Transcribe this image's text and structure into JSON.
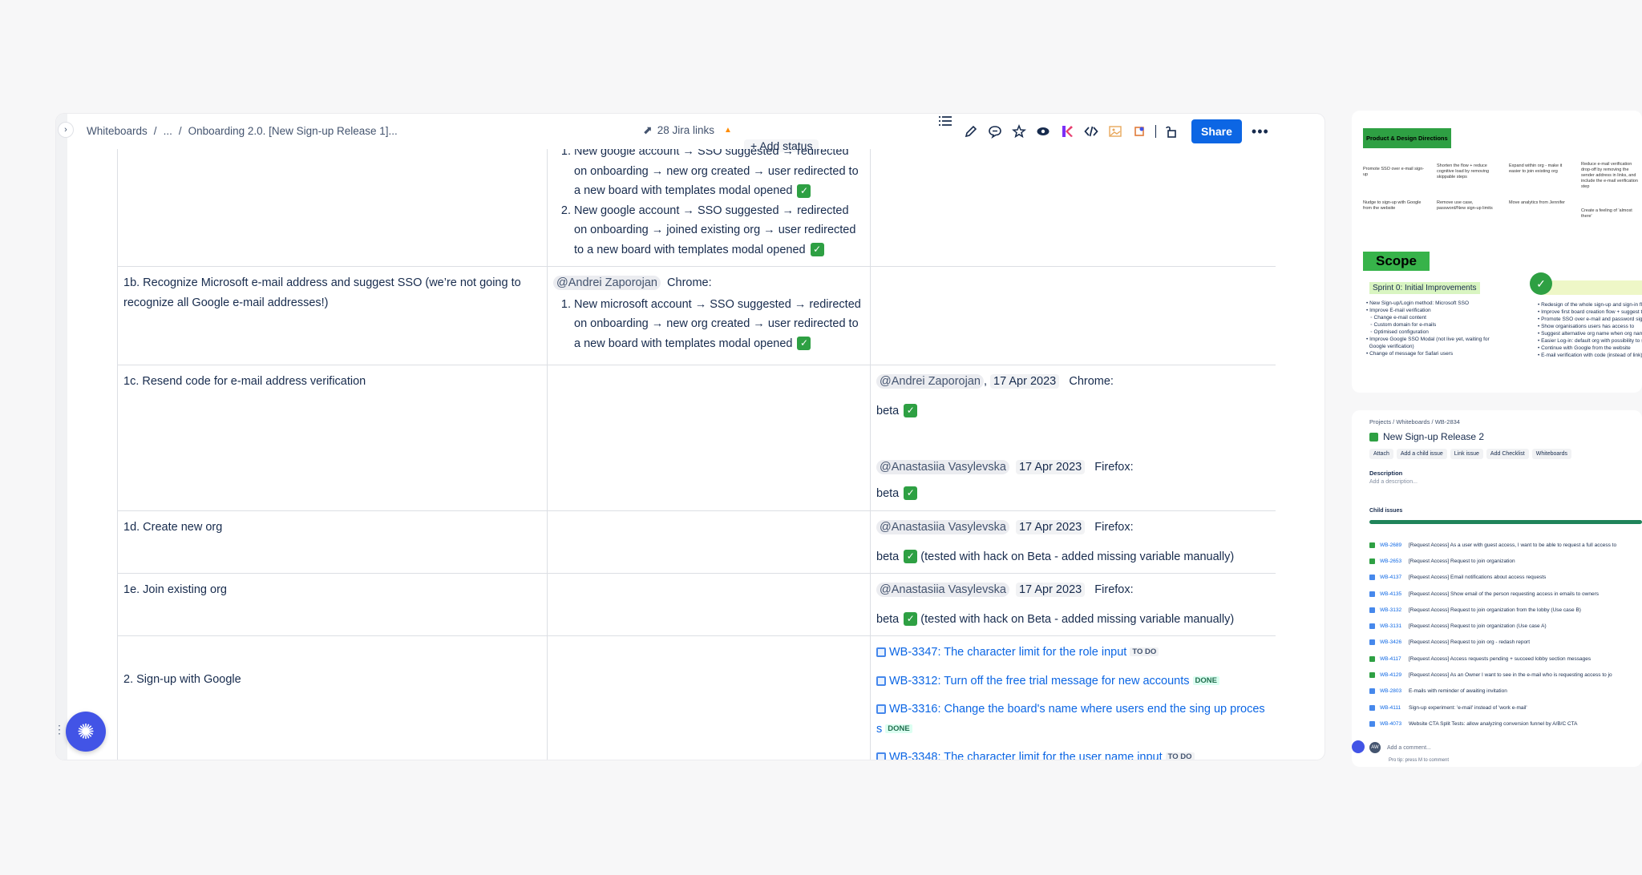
{
  "breadcrumb": {
    "items": [
      "Whiteboards",
      "/",
      "...",
      "/",
      "Onboarding 2.0. [New Sign-up Release 1]..."
    ]
  },
  "jira": {
    "label": "28 Jira links"
  },
  "add_status": "Add status",
  "toolbar": {
    "share_label": "Share"
  },
  "table": {
    "row_0": {
      "c2_items": [
        "New google account → SSO suggested → redirected on onboarding → new org created → user redirected to a new board with templates modal opened",
        "New google account → SSO suggested → redirected on onboarding → joined existing org → user redirected to a new board with templates modal opened"
      ]
    },
    "row_1b": {
      "c1": "1b. Recognize Microsoft e-mail address and suggest SSO (we’re not going to recognize all Google e-mail addresses!)",
      "c2_mention": "@Andrei Zaporojan",
      "c2_browser": "Chrome:",
      "c2_item": "New microsoft account → SSO suggested → redirected on onboarding → new org created → user redirected to a new board with templates modal opened"
    },
    "row_1c": {
      "c1": "1c. Resend code for e-mail address verification",
      "m1": "@Andrei Zaporojan",
      "sep": ",",
      "d1": "17 Apr 2023",
      "b1": "Chrome:",
      "r1": "beta",
      "m2": "@Anastasiia Vasylevska",
      "d2": "17 Apr 2023",
      "b2": "Firefox:",
      "r2": "beta"
    },
    "row_1d": {
      "c1": "1d. Create new org",
      "m": "@Anastasiia Vasylevska",
      "d": "17 Apr 2023",
      "b": "Firefox:",
      "r": "beta",
      "note": "(tested with hack on Beta - added missing variable manually)"
    },
    "row_1e": {
      "c1": "1e. Join existing org",
      "m": "@Anastasiia Vasylevska",
      "d": "17 Apr 2023",
      "b": "Firefox:",
      "r": "beta",
      "note": "(tested with hack on Beta - added missing variable manually)"
    },
    "row_2": {
      "c1": "2. Sign-up with Google",
      "issues": [
        {
          "text": "WB-3347: The character limit for the role input",
          "status": "TO DO"
        },
        {
          "text": "WB-3312: Turn off the free trial message for new accounts",
          "status": "DONE"
        },
        {
          "text": "WB-3316: Change the board's name where users end the sing up proces",
          "cont": "s",
          "status": "DONE"
        },
        {
          "text": "WB-3348: The character limit for the user name input",
          "status": "TO DO"
        }
      ]
    }
  },
  "preview1": {
    "heading": "Product & Design Directions",
    "stickies": [
      "Promote SSO over e-mail sign-up",
      "Shorten the flow + reduce cognitive load by removing skippable steps",
      "Expand within org - make it easier to join existing org",
      "Reduce e-mail verification drop-off by removing the sender address in links, and include the e-mail verification step",
      "Nudge to sign-up with Google from the website",
      "Remove use case, password/New sign-up limits",
      "Move analytics from Jennifer",
      "Create a feeling of 'almost there'"
    ],
    "scope": "Scope",
    "sprint": "Sprint 0: Initial Improvements",
    "list_left": "• New Sign-up/Login method: Microsoft SSO\n• Improve E-mail verification\n   ◦ Change e-mail content\n   ◦ Custom domain for e-mails\n   ◦ Optimised configuration\n• Improve Google SSO Modal (not live yet, waiting for\n  Google verification)\n• Change of message for Safari users",
    "list_right": "• Redesign of the whole sign-up and sign-in fl\n• Improve first board creation flow + suggest t\n• Promote SSO over e-mail and password sign\n• Show organisations users has access to\n• Suggest alternative org name when org name\n• Easier Log-in: default org with possibility to s\n• Continue with Google from the website\n• E-mail verification with code (instead of link)"
  },
  "preview2": {
    "crumbs": "Projects  /  Whiteboards  /  WB-2834",
    "title": "New Sign-up Release 2",
    "actions": [
      "Attach",
      "Add a child issue",
      "Link issue",
      "Add Checklist",
      "Whiteboards"
    ],
    "description_label": "Description",
    "description_placeholder": "Add a description...",
    "child_issues_label": "Child issues",
    "issues": [
      {
        "key": "WB-2689",
        "summary": "[Request Access] As a user with guest access, I want to be able to request a full access to"
      },
      {
        "key": "WB-2653",
        "summary": "[Request Access] Request to join organization"
      },
      {
        "key": "WB-4137",
        "summary": "[Request Access] Email notifications about access requests"
      },
      {
        "key": "WB-4135",
        "summary": "[Request Access] Show email of the person requesting access in emails to owners"
      },
      {
        "key": "WB-3132",
        "summary": "[Request Access] Request to join organization from the lobby (Use case B)"
      },
      {
        "key": "WB-3131",
        "summary": "[Request Access] Request to join organization (Use case A)"
      },
      {
        "key": "WB-3426",
        "summary": "[Request Access] Request to join org - redash report"
      },
      {
        "key": "WB-4117",
        "summary": "[Request Access] Access requests pending + succeed lobby section messages"
      },
      {
        "key": "WB-4129",
        "summary": "[Request Access] As an Owner I want to see in the e-mail who is requesting access to jo"
      },
      {
        "key": "WB-2803",
        "summary": "E-mails with reminder of awaiting invitation"
      },
      {
        "key": "WB-4111",
        "summary": "Sign-up experiment: 'e-mail' instead of 'work e-mail'"
      },
      {
        "key": "WB-4073",
        "summary": "Website CTA Split Tests: allow analyzing conversion funnel by A/B/C CTA"
      }
    ],
    "avatar": "AW",
    "comment_placeholder": "Add a comment...",
    "protip": "Pro tip: press  M  to comment"
  }
}
